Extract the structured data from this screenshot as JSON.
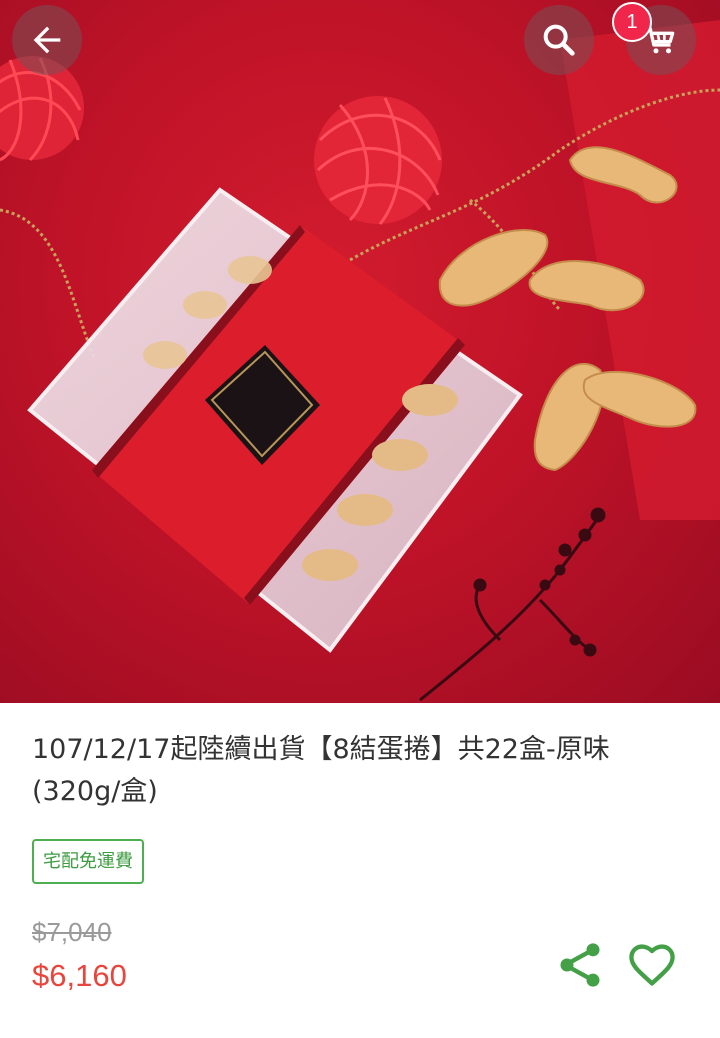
{
  "toolbar": {
    "back_icon": "arrow-left-icon",
    "search_icon": "search-icon",
    "cart_icon": "cart-icon",
    "cart_count": "1"
  },
  "product": {
    "title": "107/12/17起陸續出貨【8結蛋捲】共22盒-原味(320g/盒)",
    "tag": "宅配免運費",
    "original_price": "$7,040",
    "sale_price": "$6,160"
  },
  "actions": {
    "share_icon": "share-icon",
    "favorite_icon": "heart-outline-icon"
  },
  "colors": {
    "accent_green": "#4caf50",
    "sale_price": "#e8453c",
    "badge": "#f0264a"
  }
}
